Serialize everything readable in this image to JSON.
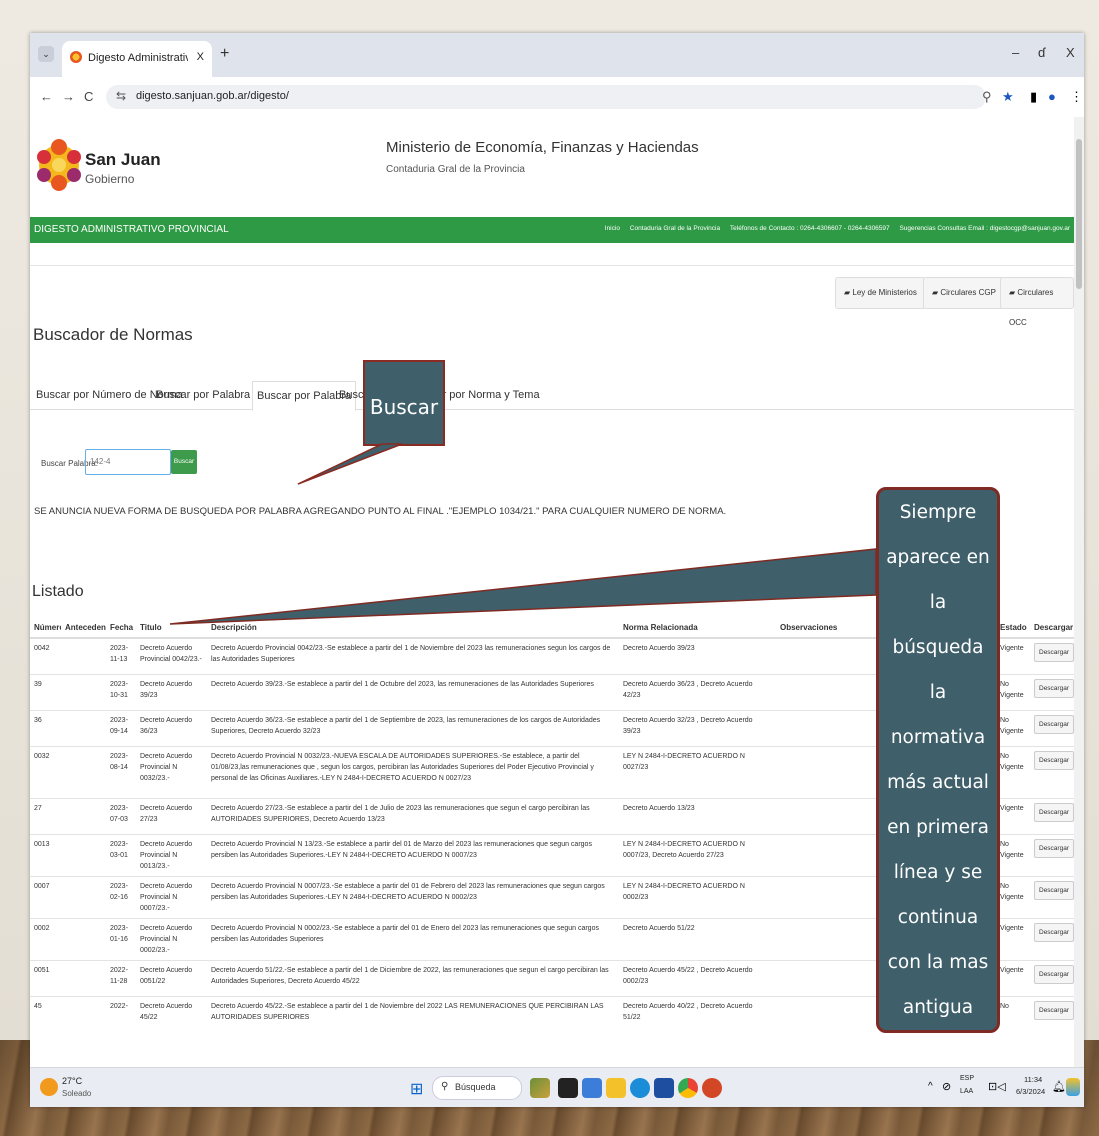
{
  "browser": {
    "tab_title": "Digesto Administrativo Provinc",
    "tab_close": "X",
    "new_tab": "+",
    "url": "digesto.sanjuan.gob.ar/digesto/",
    "win_min": "–",
    "win_restore": "ɗ",
    "win_close": "X"
  },
  "site": {
    "brand_name": "San Juan",
    "brand_sub": "Gobierno",
    "ministry": "Ministerio de Economía, Finanzas y Haciendas",
    "ministry_sub": "Contaduria Gral de la Provincia",
    "bar_title": "DIGESTO ADMINISTRATIVO PROVINCIAL",
    "bar_links": [
      "Inicio",
      "Contaduria Gral de la Provincia",
      "Teléfonos de Contacto : 0264-4306607 - 0264-4306597",
      "Sugerencias Consultas Email : digestocgp@sanjuan.gov.ar"
    ],
    "top_buttons": [
      "Ley de Ministerios",
      "Circulares CGP",
      "Circulares OCC"
    ],
    "section_title": "Buscador de Normas",
    "tabs": [
      "Buscar por Número de Norma",
      "Buscar por Palabra Clave",
      "Buscar por Palabra",
      "Buscar por Tema",
      "Buscar por Norma y Tema"
    ],
    "search_label": "Buscar Palabra:",
    "search_value": "142-4",
    "search_button": "Buscar",
    "notice": "SE ANUNCIA NUEVA FORMA DE BUSQUEDA POR PALABRA AGREGANDO PUNTO AL FINAL .\"EJEMPLO 1034/21.\" PARA CUALQUIER NUMERO DE NORMA.",
    "list_title": "Listado"
  },
  "table": {
    "headers": [
      "Número",
      "Antecedente",
      "Fecha",
      "Titulo",
      "Descripción",
      "Norma Relacionada",
      "Observaciones",
      "",
      "Estado",
      "Descargar"
    ],
    "download_label": "Descargar",
    "rows": [
      {
        "num": "0042",
        "ant": "",
        "fecha": "2023-11-13",
        "titulo": "Decreto Acuerdo Provincial 0042/23.-",
        "desc": "Decreto Acuerdo Provincial 0042/23.-Se establece a partir del 1 de Noviembre del 2023 las remuneraciones segun los cargos de las Autoridades Superiores",
        "rel": "Decreto Acuerdo 39/23",
        "estado": "Vigente"
      },
      {
        "num": "39",
        "ant": "",
        "fecha": "2023-10-31",
        "titulo": "Decreto Acuerdo 39/23",
        "desc": "Decreto Acuerdo 39/23.-Se establece a partir del 1 de Octubre del 2023, las remuneraciones de las Autoridades Superiores",
        "rel": "Decreto Acuerdo 36/23 , Decreto Acuerdo 42/23",
        "estado": "No Vigente"
      },
      {
        "num": "36",
        "ant": "",
        "fecha": "2023-09-14",
        "titulo": "Decreto Acuerdo 36/23",
        "desc": "Decreto Acuerdo 36/23.-Se establece a partir del 1 de Septiembre de 2023, las remuneraciones de los cargos de Autoridades Superiores, Decreto Acuerdo 32/23",
        "rel": "Decreto Acuerdo 32/23 , Decreto Acuerdo 39/23",
        "estado": "No Vigente"
      },
      {
        "num": "0032",
        "ant": "",
        "fecha": "2023-08-14",
        "titulo": "Decreto Acuerdo Provincial N 0032/23.-",
        "desc": "Decreto Acuerdo Provincial N 0032/23.-NUEVA ESCALA DE AUTORIDADES SUPERIORES.-Se establece, a partir del 01/08/23,las remuneraciones que , segun los cargos, percibiran las Autoridades Superiores del Poder Ejecutivo Provincial y personal de las Oficinas Auxiliares.-LEY N 2484-I-DECRETO ACUERDO N 0027/23",
        "rel": "LEY N 2484-I-DECRETO ACUERDO N 0027/23",
        "estado": "No Vigente"
      },
      {
        "num": "27",
        "ant": "",
        "fecha": "2023-07-03",
        "titulo": "Decreto Acuerdo 27/23",
        "desc": "Decreto Acuerdo 27/23.-Se establece a partir del 1 de Julio de 2023 las remuneraciones que segun el cargo percibiran las AUTORIDADES SUPERIORES, Decreto Acuerdo 13/23",
        "rel": "Decreto Acuerdo 13/23",
        "estado": "Vigente"
      },
      {
        "num": "0013",
        "ant": "",
        "fecha": "2023-03-01",
        "titulo": "Decreto Acuerdo Provincial N 0013/23.-",
        "desc": "Decreto Acuerdo Provincial N 13/23.-Se establece a partir del 01 de Marzo del 2023 las remuneraciones que segun cargos persiben las Autoridades Superiores.-LEY N 2484-I-DECRETO ACUERDO N 0007/23",
        "rel": "LEY N 2484-I-DECRETO ACUERDO N 0007/23, Decreto Acuerdo 27/23",
        "estado": "No Vigente"
      },
      {
        "num": "0007",
        "ant": "",
        "fecha": "2023-02-16",
        "titulo": "Decreto Acuerdo Provincial N 0007/23.-",
        "desc": "Decreto Acuerdo Provincial N 0007/23.-Se establece a partir del 01 de Febrero del 2023 las remuneraciones que segun cargos persiben las Autoridades Superiores.-LEY N 2484-I-DECRETO ACUERDO N 0002/23",
        "rel": "LEY N 2484-I-DECRETO ACUERDO N 0002/23",
        "estado": "No Vigente"
      },
      {
        "num": "0002",
        "ant": "",
        "fecha": "2023-01-16",
        "titulo": "Decreto Acuerdo Provincial N 0002/23.-",
        "desc": "Decreto Acuerdo Provincial N 0002/23.-Se establece a partir del 01 de Enero del 2023 las remuneraciones que segun cargos persiben las Autoridades Superiores",
        "rel": "Decreto Acuerdo 51/22",
        "estado": "Vigente"
      },
      {
        "num": "0051",
        "ant": "",
        "fecha": "2022-11-28",
        "titulo": "Decreto Acuerdo 0051/22",
        "desc": "Decreto Acuerdo 51/22.-Se establece a partir del 1 de Diciembre de 2022, las remuneraciones que segun el cargo percibiran las Autoridades Superiores, Decreto Acuerdo 45/22",
        "rel": "Decreto Acuerdo 45/22 , Decreto Acuerdo 0002/23",
        "estado": "Vigente"
      },
      {
        "num": "45",
        "ant": "",
        "fecha": "2022-",
        "titulo": "Decreto Acuerdo 45/22",
        "desc": "Decreto Acuerdo 45/22.-Se establece a partir del 1 de Noviembre del 2022 LAS REMUNERACIONES QUE PERCIBIRAN LAS AUTORIDADES SUPERIORES",
        "rel": "Decreto Acuerdo 40/22 , Decreto Acuerdo 51/22",
        "estado": "No"
      }
    ]
  },
  "callouts": {
    "buscar": "Buscar",
    "lines": [
      "Siempre",
      "aparece en",
      "la",
      "búsqueda",
      "la",
      "normativa",
      "más actual",
      "en primera",
      "línea y se",
      "continua",
      "con la mas",
      "antigua"
    ]
  },
  "taskbar": {
    "temp": "27°C",
    "weather": "Soleado",
    "search": "Búsqueda",
    "lang1": "ESP",
    "lang2": "LAA",
    "time": "11:34",
    "date": "6/3/2024"
  },
  "colors": {
    "green_bar": "#2e9a45",
    "callout_fill": "#3f5f6a",
    "callout_border": "#7f2b23"
  }
}
